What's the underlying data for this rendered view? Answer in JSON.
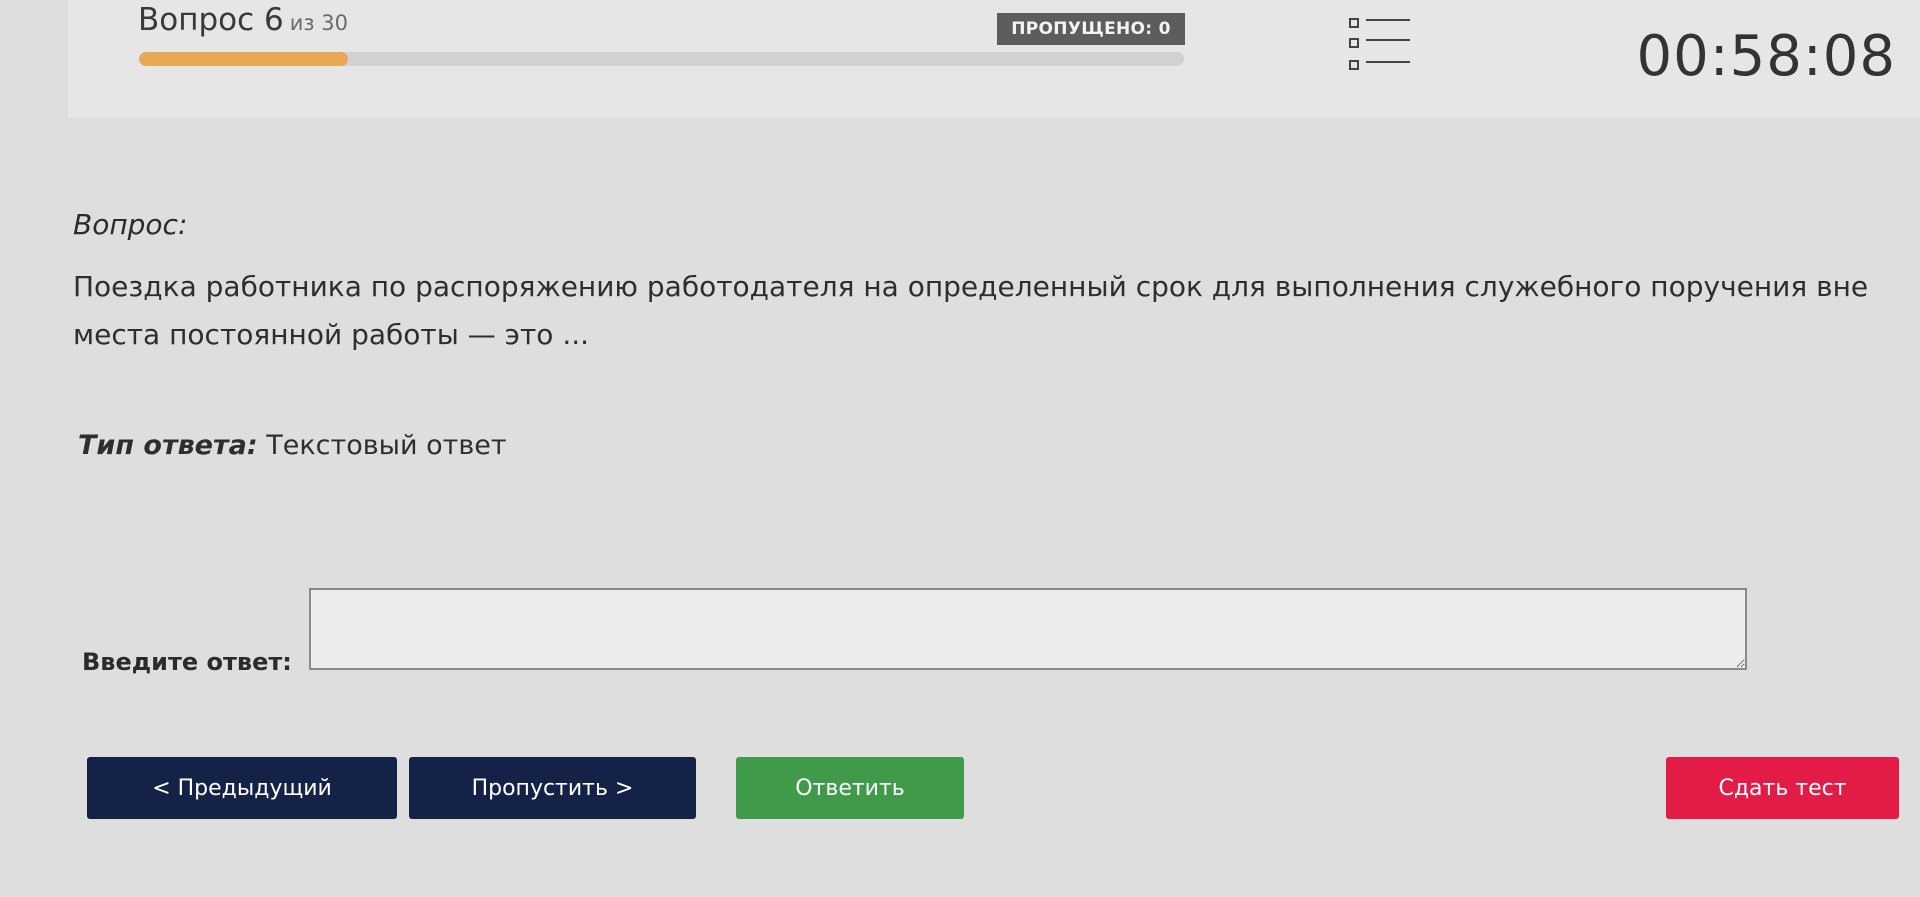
{
  "header": {
    "question_label": "Вопрос 6",
    "question_of": "из 30",
    "progress_fraction": 0.2,
    "skipped_label": "ПРОПУЩЕНО: 0",
    "list_icon": "question-list-icon",
    "timer": "00:58:08"
  },
  "question": {
    "label": "Вопрос:",
    "text": "Поездка работника по распоряжению работодателя на определенный срок для выполнения служебного поручения вне места постоянной работы — это ..."
  },
  "answer_type": {
    "label": "Тип ответа:",
    "value": "Текстовый ответ"
  },
  "answer_input": {
    "label": "Введите ответ:",
    "value": ""
  },
  "buttons": {
    "prev": "< Предыдущий",
    "skip": "Пропустить >",
    "answer": "Ответить",
    "submit": "Сдать тест"
  },
  "colors": {
    "progress_fill": "#e8a955",
    "nav_button": "#142248",
    "answer_button": "#3f9b4a",
    "submit_button": "#e21c46",
    "skipped_badge": "#5d5d5d"
  }
}
